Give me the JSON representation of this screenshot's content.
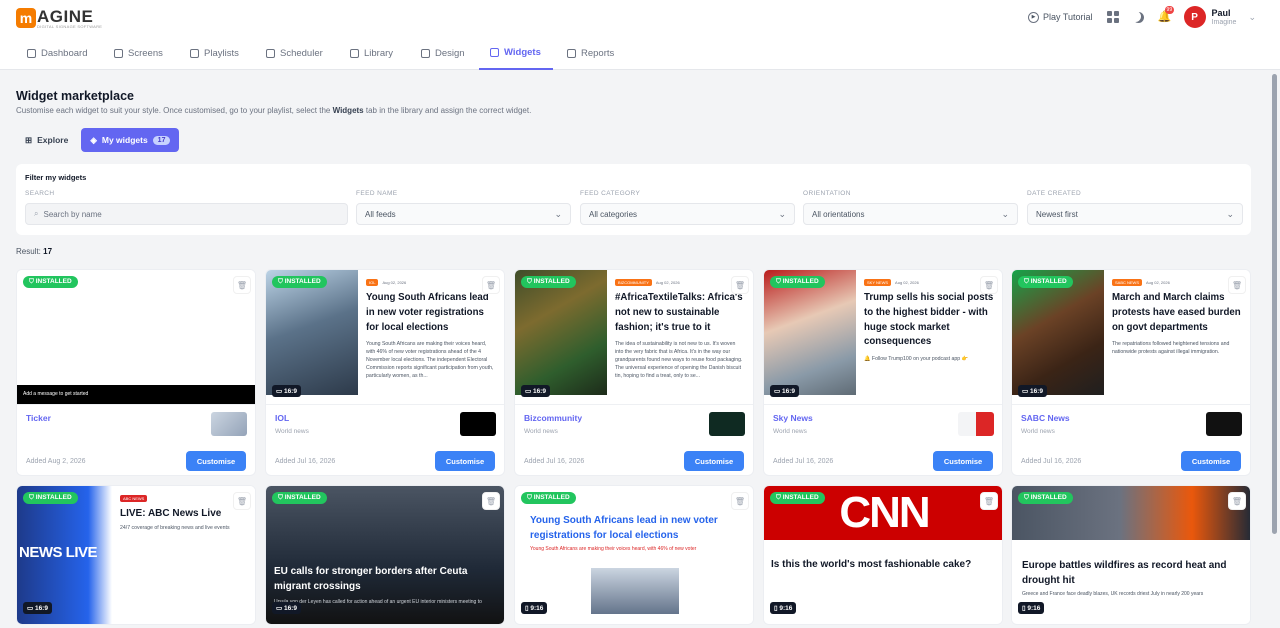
{
  "logo": {
    "mark": "m",
    "text": "AGINE",
    "subtitle": "DIGITAL SIGNAGE SOFTWARE"
  },
  "topbar": {
    "play_tutorial": "Play Tutorial",
    "notification_count": "99",
    "user_initial": "P",
    "user_name": "Paul",
    "user_role": "Imagine"
  },
  "nav": [
    {
      "label": "Dashboard",
      "icon": "dashboard-icon"
    },
    {
      "label": "Screens",
      "icon": "monitor-icon"
    },
    {
      "label": "Playlists",
      "icon": "playlist-icon"
    },
    {
      "label": "Scheduler",
      "icon": "calendar-icon"
    },
    {
      "label": "Library",
      "icon": "folder-icon"
    },
    {
      "label": "Design",
      "icon": "palette-icon"
    },
    {
      "label": "Widgets",
      "icon": "widgets-icon",
      "active": true
    },
    {
      "label": "Reports",
      "icon": "chart-icon"
    }
  ],
  "page": {
    "title": "Widget marketplace",
    "desc_pre": "Customise each widget to suit your style. Once customised, go to your playlist, select the ",
    "desc_bold": "Widgets",
    "desc_post": " tab in the library and assign the correct widget."
  },
  "tabs": {
    "explore": "Explore",
    "my_widgets": "My widgets",
    "my_widgets_count": "17"
  },
  "filter": {
    "heading": "Filter my widgets",
    "search_label": "SEARCH",
    "search_placeholder": "Search by name",
    "feed_label": "FEED NAME",
    "feed_value": "All feeds",
    "category_label": "FEED CATEGORY",
    "category_value": "All categories",
    "orientation_label": "ORIENTATION",
    "orientation_value": "All orientations",
    "date_label": "DATE CREATED",
    "date_value": "Newest first"
  },
  "result": {
    "label": "Result:",
    "count": "17"
  },
  "common": {
    "installed": "INSTALLED",
    "customise": "Customise"
  },
  "cards_row1": [
    {
      "name": "Ticker",
      "feed": "",
      "added": "Added Aug 2, 2026",
      "ticker_msg": "Add a message to get started",
      "ratio": "16:9"
    },
    {
      "name": "IOL",
      "feed": "World news",
      "added": "Added Jul 16, 2026",
      "ratio": "16:9",
      "tag": "IOL",
      "date": "Aug 02, 2026",
      "headline": "Young South Africans lead in new voter registrations for local elections",
      "body": "Young South Africans are making their voices heard, with 46% of new voter registrations ahead of the 4 November local elections. The independent Electoral Commission reports significant participation from youth, particularly women, as th..."
    },
    {
      "name": "Bizcommunity",
      "feed": "World news",
      "added": "Added Jul 16, 2026",
      "ratio": "16:9",
      "tag": "BIZCOMMUNITY",
      "date": "Aug 02, 2026",
      "headline": "#AfricaTextileTalks: Africa's not new to sustainable fashion; it's true to it",
      "body": "The idea of sustainability is not new to us. It's woven into the very fabric that is Africa. It's in the way our grandparents found new ways to reuse food packaging. The universal experience of opening the Danish biscuit tin, hoping to find a treat, only to se..."
    },
    {
      "name": "Sky News",
      "feed": "World news",
      "added": "Added Jul 16, 2026",
      "ratio": "16:9",
      "tag": "SKY NEWS",
      "date": "Aug 02, 2026",
      "headline": "Trump sells his social posts to the highest bidder - with huge stock market consequences",
      "body": "🔔 Follow Trump100 on your podcast app 👉"
    },
    {
      "name": "SABC News",
      "feed": "World news",
      "added": "Added Jul 16, 2026",
      "ratio": "16:9",
      "tag": "SABC NEWS",
      "date": "Aug 02, 2026",
      "headline": "March and March claims protests have eased burden on govt departments",
      "body": "The repatriations followed heightened tensions and nationwide protests against illegal immigration."
    }
  ],
  "cards_row2": [
    {
      "ratio": "16:9",
      "brand": "NEWS LIVE",
      "tag": "ABC NEWS",
      "headline": "LIVE: ABC News Live",
      "body": "24/7 coverage of breaking news and live events"
    },
    {
      "ratio": "16:9",
      "headline": "EU calls for stronger borders after Ceuta migrant crossings",
      "body": "Ursula von der Leyen has called for action ahead of an urgent EU interior ministers meeting to"
    },
    {
      "ratio": "9:16",
      "headline": "Young South Africans lead in new voter registrations for local elections",
      "body": "Young South Africans are making their voices heard, with 46% of new voter"
    },
    {
      "ratio": "9:16",
      "brand": "CNN",
      "headline": "Is this the world's most fashionable cake?"
    },
    {
      "ratio": "9:16",
      "headline": "Europe battles wildfires as record heat and drought hit",
      "body": "Greece and France face deadly blazes, UK records driest July in nearly 200 years"
    }
  ]
}
